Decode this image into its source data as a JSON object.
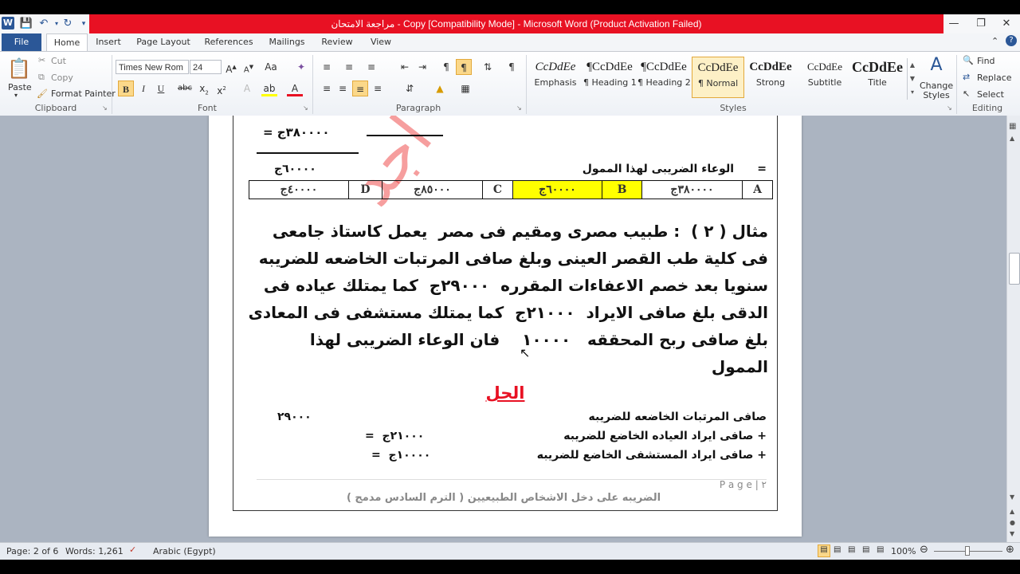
{
  "window": {
    "title": "مراجعة الامتحان - Copy [Compatibility Mode]  -  Microsoft Word (Product Activation Failed)",
    "app_icon_letter": "W"
  },
  "menu": {
    "file": "File",
    "tabs": [
      "Home",
      "Insert",
      "Page Layout",
      "References",
      "Mailings",
      "Review",
      "View"
    ]
  },
  "ribbon": {
    "clipboard": {
      "paste": "Paste",
      "cut": "Cut",
      "copy": "Copy",
      "format_painter": "Format Painter",
      "label": "Clipboard"
    },
    "font": {
      "family": "Times New Rom",
      "size": "24",
      "label": "Font"
    },
    "paragraph": {
      "label": "Paragraph"
    },
    "styles": {
      "label": "Styles",
      "items": [
        {
          "sample": "CcDdEe",
          "name": "Emphasis"
        },
        {
          "sample": "¶CcDdEe",
          "name": "¶ Heading 1"
        },
        {
          "sample": "¶CcDdEe",
          "name": "¶ Heading 2"
        },
        {
          "sample": "CcDdEe",
          "name": "¶ Normal"
        },
        {
          "sample": "CcDdEe",
          "name": "Strong"
        },
        {
          "sample": "CcDdEe",
          "name": "Subtitle"
        },
        {
          "sample": "CcDdEe",
          "name": "Title"
        }
      ],
      "change_styles": "Change Styles"
    },
    "editing": {
      "find": "Find",
      "replace": "Replace",
      "select": "Select",
      "label": "Editing"
    }
  },
  "document": {
    "top_value": "٣٨٠٠٠٠ج   =",
    "tax_base_label": "=      الوعاء الضريبى لهذا الممول",
    "tax_base_value": "٦٠٠٠٠ج",
    "table": [
      {
        "text": "A",
        "highlight": false
      },
      {
        "text": "٣٨٠٠٠٠ج",
        "highlight": false
      },
      {
        "text": "B",
        "highlight": true
      },
      {
        "text": "٦٠٠٠٠ج",
        "highlight": true
      },
      {
        "text": "C",
        "highlight": false
      },
      {
        "text": "٨٥٠٠٠ج",
        "highlight": false
      },
      {
        "text": "D",
        "highlight": false
      },
      {
        "text": "٤٠٠٠٠ج",
        "highlight": false
      }
    ],
    "example_lines": [
      "مثال ( ٢ )  : طبيب مصرى ومقيم فى مصر  يعمل كاستاذ جامعى",
      "فى كلية طب القصر العينى وبلغ صافى المرتبات الخاضعه للضريبه",
      "سنويا بعد خصم الاعفاءات المقرره  ٢٩٠٠٠ج  كما يمتلك عياده فى",
      "الدقى بلغ صافى الايراد  ٢١٠٠٠ج  كما يمتلك مستشفى فى المعادى",
      "بلغ صافى ربح المحققه   ١٠٠٠٠    فان الوعاء الضريبى لهذا",
      "الممول"
    ],
    "solution_title": "الحل",
    "solution_rows": [
      {
        "label": "صافى المرتبات الخاضعه للضريبه",
        "value": "٢٩٠٠٠"
      },
      {
        "label": "+ صافى ايراد العياده الخاضع للضريبه",
        "value": "٢١٠٠٠ج  ="
      },
      {
        "label": "+ صافى ايراد المستشفى الخاضع للضريبه",
        "value": "١٠٠٠٠ج  ="
      }
    ],
    "page_number": "٢ | P a g e",
    "footer": "الضريبه على دخل الاشخاص الطبيعيين ( الترم السادس مدمج  )",
    "watermark": "اجد"
  },
  "status": {
    "page": "Page: 2 of 6",
    "words": "Words: 1,261",
    "language": "Arabic (Egypt)",
    "zoom": "100%"
  }
}
